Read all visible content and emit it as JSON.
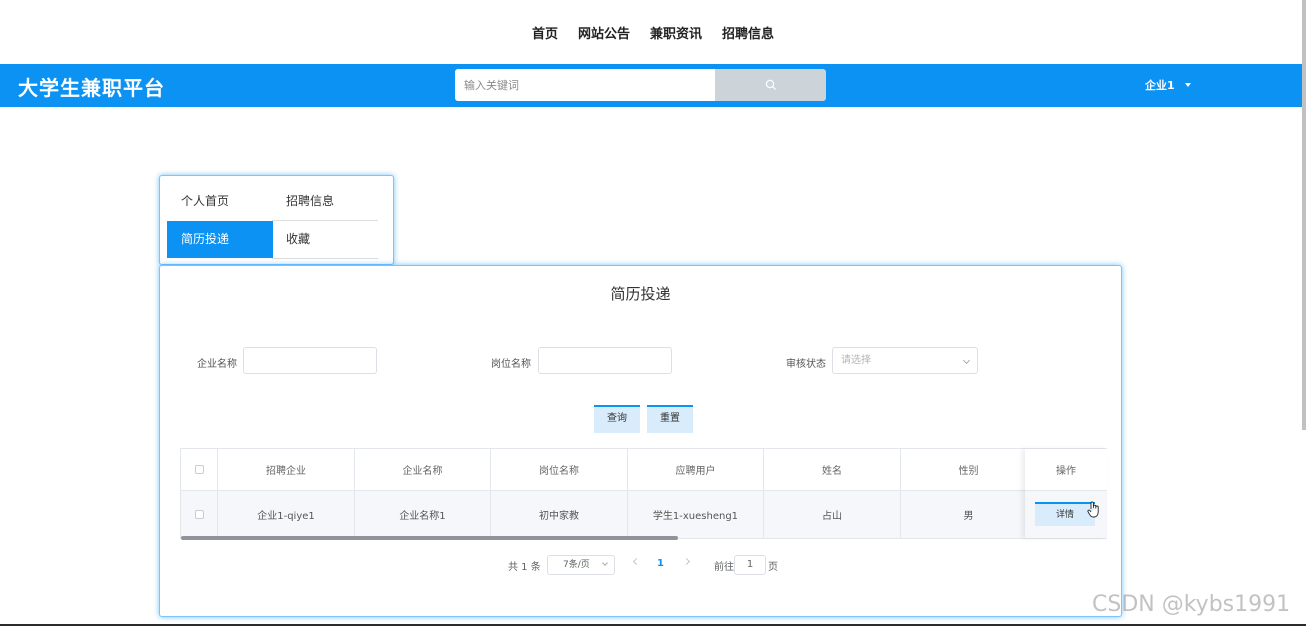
{
  "top_nav": {
    "items": [
      "首页",
      "网站公告",
      "兼职资讯",
      "招聘信息"
    ]
  },
  "header": {
    "brand": "大学生兼职平台",
    "search_placeholder": "输入关键词",
    "search_icon": "search-icon",
    "user_name": "企业1",
    "accent_color": "#0b92f2"
  },
  "side_menu": {
    "items": [
      "个人首页",
      "招聘信息",
      "简历投递",
      "收藏"
    ],
    "active": "简历投递"
  },
  "panel": {
    "title": "简历投递",
    "filters": {
      "company_label": "企业名称",
      "company_value": "",
      "position_label": "岗位名称",
      "position_value": "",
      "status_label": "审核状态",
      "status_placeholder": "请选择"
    },
    "buttons": {
      "query": "查询",
      "reset": "重置"
    },
    "table": {
      "headers": [
        "招聘企业",
        "企业名称",
        "岗位名称",
        "应聘用户",
        "姓名",
        "性别",
        "操作"
      ],
      "rows": [
        {
          "recruiter": "企业1-qiye1",
          "company": "企业名称1",
          "position": "初中家教",
          "applicant": "学生1-xuesheng1",
          "name": "占山",
          "gender": "男",
          "action": "详情"
        }
      ]
    },
    "pagination": {
      "total": "共 1 条",
      "page_size": "7条/页",
      "current_page": "1",
      "goto_label": "前往",
      "goto_value": "1",
      "page_suffix": "页"
    }
  },
  "watermark": "CSDN @kybs1991"
}
